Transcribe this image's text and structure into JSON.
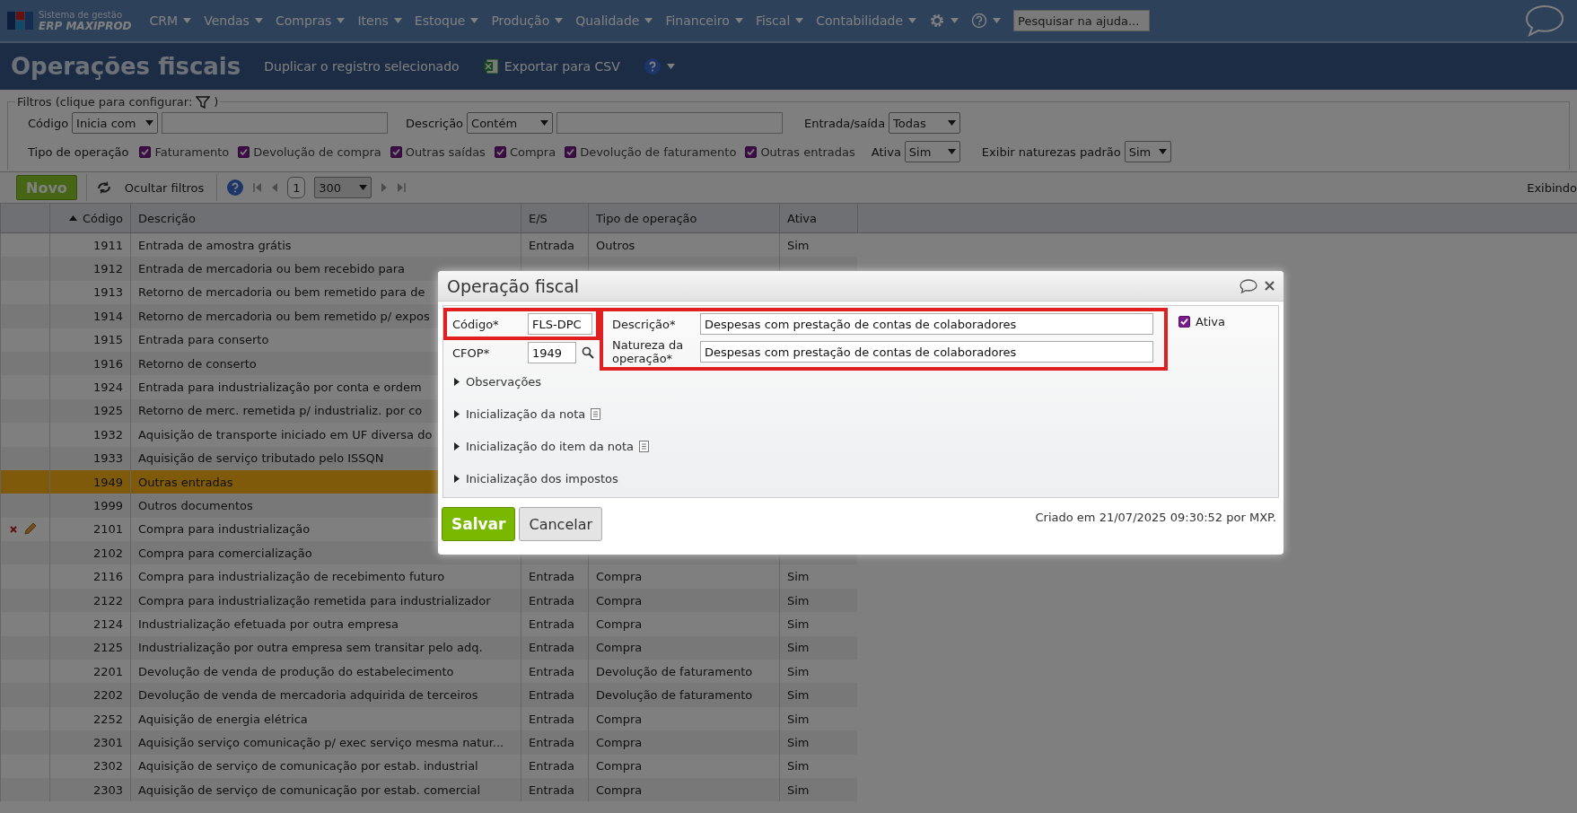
{
  "nav": {
    "logo_line1": "Sistema de gestão",
    "logo_line2": "ERP MAXIPROD",
    "menus": [
      "CRM",
      "Vendas",
      "Compras",
      "Itens",
      "Estoque",
      "Produção",
      "Qualidade",
      "Financeiro",
      "Fiscal",
      "Contabilidade"
    ],
    "search": {
      "placeholder": "Pesquisar na ajuda..."
    }
  },
  "header": {
    "title": "Operações fiscais",
    "actions": [
      {
        "kind": "text",
        "label": "Duplicar o registro selecionado"
      },
      {
        "kind": "excel",
        "label": "Exportar para CSV"
      }
    ]
  },
  "filters": {
    "legend": "Filtros (clique para configurar:",
    "legend_end": ")",
    "code_label": "Código",
    "code_mode": "Inicia com",
    "description_label": "Descrição",
    "description_mode": "Contém",
    "direction_label": "Entrada/saída",
    "direction_value": "Todas",
    "type_label": "Tipo de operação",
    "types": [
      {
        "label": "Faturamento",
        "checked": true
      },
      {
        "label": "Devolução de compra",
        "checked": true
      },
      {
        "label": "Outras saídas",
        "checked": true
      },
      {
        "label": "Compra",
        "checked": true
      },
      {
        "label": "Devolução de faturamento",
        "checked": true
      },
      {
        "label": "Outras entradas",
        "checked": true
      }
    ],
    "active_label": "Ativa",
    "active_value": "Sim",
    "defaults_label": "Exibir naturezas padrão",
    "defaults_value": "Sim"
  },
  "toolbar": {
    "new": "Novo",
    "hide_filters": "Ocultar filtros",
    "page": "1",
    "page_size": "300",
    "showing": "Exibindo"
  },
  "table": {
    "columns": [
      "Código",
      "Descrição",
      "E/S",
      "Tipo de operação",
      "Ativa"
    ],
    "rows": [
      {
        "code": "1911",
        "description": "Entrada de amostra grátis",
        "es": "Entrada",
        "type": "Outros",
        "active": "Sim",
        "selected": false,
        "hovered": false
      },
      {
        "code": "1912",
        "description": "Entrada de mercadoria ou bem recebido para",
        "selected": false,
        "hovered": false
      },
      {
        "code": "1913",
        "description": "Retorno de mercadoria ou bem remetido para de",
        "selected": false,
        "hovered": false
      },
      {
        "code": "1914",
        "description": "Retorno de mercadoria ou bem remetido p/ expos",
        "selected": false,
        "hovered": false
      },
      {
        "code": "1915",
        "description": "Entrada para conserto",
        "selected": false,
        "hovered": false
      },
      {
        "code": "1916",
        "description": "Retorno de conserto",
        "selected": false,
        "hovered": false
      },
      {
        "code": "1924",
        "description": "Entrada para industrialização por conta e ordem",
        "selected": false,
        "hovered": false
      },
      {
        "code": "1925",
        "description": "Retorno de merc. remetida p/ industrializ. por co",
        "selected": false,
        "hovered": false
      },
      {
        "code": "1932",
        "description": "Aquisição de transporte iniciado em UF diversa do",
        "selected": false,
        "hovered": false
      },
      {
        "code": "1933",
        "description": "Aquisição de serviço tributado pelo ISSQN",
        "selected": false,
        "hovered": false
      },
      {
        "code": "1949",
        "description": "Outras entradas",
        "selected": true,
        "hovered": false
      },
      {
        "code": "1999",
        "description": "Outros documentos",
        "selected": false,
        "hovered": false
      },
      {
        "code": "2101",
        "description": "Compra para industrialização",
        "selected": false,
        "hovered": true
      },
      {
        "code": "2102",
        "description": "Compra para comercialização",
        "selected": false,
        "hovered": false
      },
      {
        "code": "2116",
        "description": "Compra para industrialização de recebimento futuro",
        "es": "Entrada",
        "type": "Compra",
        "active": "Sim",
        "selected": false,
        "hovered": false
      },
      {
        "code": "2122",
        "description": "Compra para industrialização remetida para industrializador",
        "es": "Entrada",
        "type": "Compra",
        "active": "Sim",
        "selected": false,
        "hovered": false
      },
      {
        "code": "2124",
        "description": "Industrialização efetuada por outra empresa",
        "es": "Entrada",
        "type": "Compra",
        "active": "Sim",
        "selected": false,
        "hovered": false
      },
      {
        "code": "2125",
        "description": "Industrialização por outra empresa sem transitar pelo adq.",
        "es": "Entrada",
        "type": "Compra",
        "active": "Sim",
        "selected": false,
        "hovered": false
      },
      {
        "code": "2201",
        "description": "Devolução de venda de produção do estabelecimento",
        "es": "Entrada",
        "type": "Devolução de faturamento",
        "active": "Sim",
        "selected": false,
        "hovered": false
      },
      {
        "code": "2202",
        "description": "Devolução de venda de mercadoria adquirida de terceiros",
        "es": "Entrada",
        "type": "Devolução de faturamento",
        "active": "Sim",
        "selected": false,
        "hovered": false
      },
      {
        "code": "2252",
        "description": "Aquisição de energia elétrica",
        "es": "Entrada",
        "type": "Compra",
        "active": "Sim",
        "selected": false,
        "hovered": false
      },
      {
        "code": "2301",
        "description": "Aquisição serviço comunicação p/ exec serviço mesma natur...",
        "es": "Entrada",
        "type": "Compra",
        "active": "Sim",
        "selected": false,
        "hovered": false
      },
      {
        "code": "2302",
        "description": "Aquisição de serviço de comunicação por estab. industrial",
        "es": "Entrada",
        "type": "Compra",
        "active": "Sim",
        "selected": false,
        "hovered": false
      },
      {
        "code": "2303",
        "description": "Aquisição de serviço de comunicação por estab. comercial",
        "es": "Entrada",
        "type": "Compra",
        "active": "Sim",
        "selected": false,
        "hovered": false
      }
    ]
  },
  "dialog": {
    "title": "Operação fiscal",
    "code": {
      "label": "Código*",
      "value": "FLS-DPC"
    },
    "cfop": {
      "label": "CFOP*",
      "value": "1949"
    },
    "description": {
      "label": "Descrição*",
      "value": "Despesas com prestação de contas de colaboradores"
    },
    "nature": {
      "label": "Natureza da operação*",
      "value": "Despesas com prestação de contas de colaboradores"
    },
    "active": {
      "label": "Ativa",
      "checked": true
    },
    "sections": [
      {
        "label": "Observações",
        "expanded": false,
        "doc_icon": false
      },
      {
        "label": "Inicialização da nota",
        "expanded": false,
        "doc_icon": true
      },
      {
        "label": "Inicialização do item da nota",
        "expanded": false,
        "doc_icon": true
      },
      {
        "label": "Inicialização dos impostos",
        "expanded": false,
        "doc_icon": false
      }
    ],
    "save": "Salvar",
    "cancel": "Cancelar",
    "created": "Criado em 21/07/2025 09:30:52 por MXP."
  }
}
